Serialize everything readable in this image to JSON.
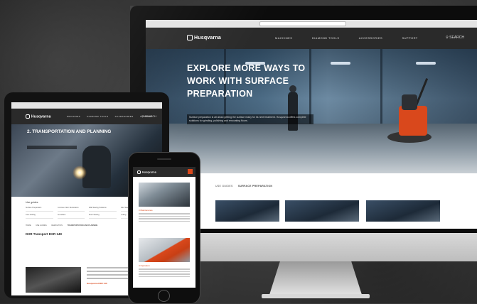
{
  "brand": {
    "name": "Husqvarna",
    "accent": "#d9481c"
  },
  "desktop": {
    "nav": [
      "MACHINES",
      "DIAMOND TOOLS",
      "ACCESSORIES",
      "SUPPORT"
    ],
    "search_label": "SEARCH",
    "hero_title": "EXPLORE MORE WAYS TO WORK WITH SURFACE PREPARATION",
    "hero_lead": "Surface preparation is all about getting the surface ready for its next treatment. Husqvarna offers complete solutions for grinding, polishing and renovating floors.",
    "breadcrumb": [
      "USE GUIDES",
      "SURFACE PREPARATION"
    ]
  },
  "tablet": {
    "nav": [
      "MACHINES",
      "DIAMOND TOOLS",
      "ACCESSORIES",
      "SUPPORT"
    ],
    "search_label": "SEARCH",
    "hero_title": "2. TRANSPORTATION AND PLANNING",
    "menu_heading": "Use guides",
    "menu_items": [
      "Surface Preparation",
      "Concrete Floor Restoration",
      "Wall Sawing Solutions",
      "Wire Sawing Solutions",
      "Core Drilling",
      "Demolition",
      "Floor Sawing",
      "Cutting"
    ],
    "breadcrumb": [
      "HOME",
      "USE GUIDES",
      "DEMOLITION",
      "TRANSPORTATION AND PLANNING"
    ],
    "section_heading": "DXR Transport DXR 140",
    "link_text": "Husqvarna DXR 140"
  },
  "phone": {
    "card_labels": [
      "3 Maintenance",
      "4 Operation"
    ]
  }
}
